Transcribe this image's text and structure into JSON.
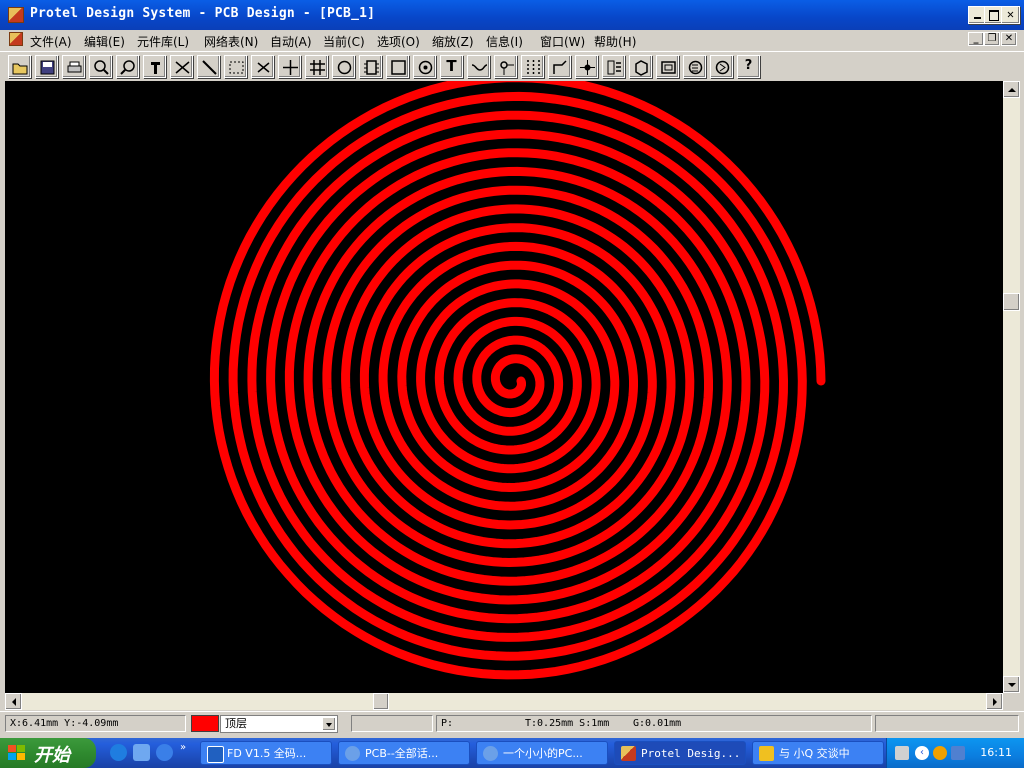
{
  "window": {
    "title": "Protel Design System - PCB Design - [PCB_1]",
    "caption_buttons": [
      "minimize-icon",
      "maximize-icon",
      "close-icon"
    ]
  },
  "menubar": {
    "items": [
      "文件(A)",
      "编辑(E)",
      "元件库(L)",
      "网络表(N)",
      "自动(A)",
      "当前(C)",
      "选项(O)",
      "缩放(Z)",
      "信息(I)",
      "窗口(W)",
      "帮助(H)"
    ]
  },
  "toolbar": {
    "buttons": [
      {
        "icon": "open-folder-icon"
      },
      {
        "icon": "save-icon"
      },
      {
        "icon": "print-icon"
      },
      {
        "icon": "zoom-in-icon"
      },
      {
        "icon": "zoom-out-icon"
      },
      {
        "icon": "probe-icon"
      },
      {
        "icon": "cut-icon"
      },
      {
        "icon": "line-icon"
      },
      {
        "icon": "select-rect-icon"
      },
      {
        "icon": "deselect-icon"
      },
      {
        "icon": "move-cross-icon"
      },
      {
        "icon": "grid-icon"
      },
      {
        "icon": "arc-icon"
      },
      {
        "icon": "component-icon"
      },
      {
        "icon": "fill-icon"
      },
      {
        "icon": "via-icon"
      },
      {
        "icon": "text-icon",
        "glyph": "T"
      },
      {
        "icon": "track-icon"
      },
      {
        "icon": "pad-icon"
      },
      {
        "icon": "array-icon"
      },
      {
        "icon": "route-icon"
      },
      {
        "icon": "origin-icon"
      },
      {
        "icon": "layer-icon"
      },
      {
        "icon": "cube-icon"
      },
      {
        "icon": "board-icon"
      },
      {
        "icon": "rotate-icon"
      },
      {
        "icon": "flip-icon"
      },
      {
        "icon": "help-icon",
        "glyph": "?"
      }
    ]
  },
  "canvas": {
    "background": "#000000",
    "trace_color": "#ff0000",
    "content": "spiral-coil-trace"
  },
  "statusbar": {
    "coords": "X:6.41mm Y:-4.09mm",
    "layer_color": "#ff0000",
    "layer": "顶层",
    "p_label": "P:",
    "track": "T:0.25mm S:1mm",
    "grid": "G:0.01mm"
  },
  "taskbar": {
    "start_label": "开始",
    "tasks": [
      {
        "label": "FD V1.5 全码..."
      },
      {
        "label": "PCB--全部话..."
      },
      {
        "label": "一个小小的PC..."
      },
      {
        "label": "Protel Desig..."
      },
      {
        "label": "与 小Q 交谈中"
      }
    ],
    "clock": "16:11"
  }
}
